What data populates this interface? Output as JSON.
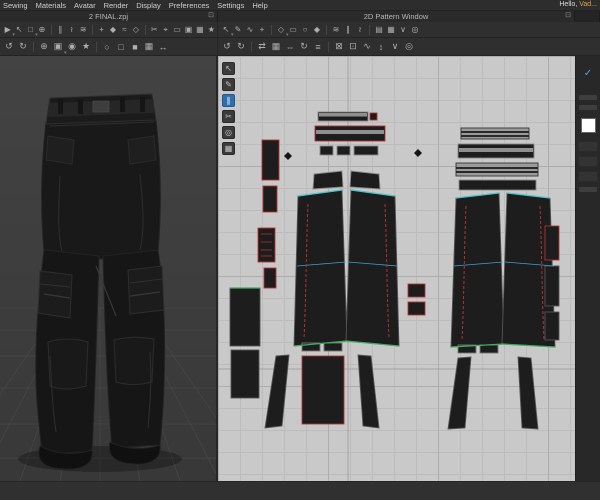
{
  "colors": {
    "accent_blue": "#4aa3e8",
    "selection_red": "#b03434",
    "seam_cyan": "#45c8d2",
    "seam_green": "#3fae5f",
    "greeting_name_color": "#e0a33c",
    "pattern_canvas_bg": "#c9c9c9",
    "viewport_bg": "#3e3e3e"
  },
  "menu_bar": {
    "items": [
      "Sewing",
      "Materials",
      "Avatar",
      "Render",
      "Display",
      "Preferences",
      "Settings",
      "Help"
    ],
    "greeting_prefix": "Hello, ",
    "greeting_name": "Vad..."
  },
  "title_bar": {
    "left_tab": "2 FINAL.zpj",
    "right_tab": "2D Pattern Window",
    "window_control_glyph": "⊡"
  },
  "toolbars": {
    "row1_3d": [
      {
        "name": "simulate",
        "glyph": "▶",
        "caret": true
      },
      {
        "name": "select-move",
        "glyph": "↖"
      },
      {
        "name": "select-mesh",
        "glyph": "□",
        "caret": true
      },
      {
        "name": "pin",
        "glyph": "⊕"
      },
      {
        "sep": true
      },
      {
        "name": "segment-sewing",
        "glyph": "∥"
      },
      {
        "name": "free-sewing",
        "glyph": "≀"
      },
      {
        "name": "show-sewing",
        "glyph": "≋"
      },
      {
        "sep": true
      },
      {
        "name": "pinch",
        "glyph": "+"
      },
      {
        "name": "tack",
        "glyph": "◆"
      },
      {
        "name": "steam",
        "glyph": "≈"
      },
      {
        "name": "fold-arrangement",
        "glyph": "◇"
      },
      {
        "sep": true
      },
      {
        "name": "scissors",
        "glyph": "✂"
      },
      {
        "name": "measure",
        "glyph": "⌖"
      },
      {
        "name": "tape",
        "glyph": "▭"
      },
      {
        "name": "flatten",
        "glyph": "▣"
      },
      {
        "name": "grid-3d",
        "glyph": "▦"
      },
      {
        "name": "render",
        "glyph": "★"
      }
    ],
    "row1_2d": [
      {
        "name": "transform-pattern",
        "glyph": "↖",
        "caret": true
      },
      {
        "name": "edit-pattern",
        "glyph": "✎"
      },
      {
        "name": "edit-curvature",
        "glyph": "∿"
      },
      {
        "name": "add-point",
        "glyph": "+"
      },
      {
        "sep": true
      },
      {
        "name": "polygon",
        "glyph": "◇",
        "caret": true
      },
      {
        "name": "rectangle",
        "glyph": "▭"
      },
      {
        "name": "circle",
        "glyph": "○"
      },
      {
        "name": "dart",
        "glyph": "◆"
      },
      {
        "sep": true
      },
      {
        "name": "seam-allowance",
        "glyph": "≋"
      },
      {
        "name": "segment-sewing-2d",
        "glyph": "∥"
      },
      {
        "name": "free-sewing-2d",
        "glyph": "≀"
      },
      {
        "sep": true
      },
      {
        "name": "grading",
        "glyph": "▤"
      },
      {
        "name": "texture-editor",
        "glyph": "▦"
      },
      {
        "name": "notch",
        "glyph": "∨"
      },
      {
        "name": "zoom",
        "glyph": "◎"
      }
    ],
    "row2_3d": [
      {
        "name": "undo",
        "glyph": "↺"
      },
      {
        "name": "redo",
        "glyph": "↻"
      },
      {
        "sep": true
      },
      {
        "name": "reset-arrangement",
        "glyph": "⊕"
      },
      {
        "name": "camera-view",
        "glyph": "▣",
        "caret": true
      },
      {
        "name": "snapshot",
        "glyph": "◉"
      },
      {
        "name": "render-image",
        "glyph": "★"
      },
      {
        "sep": true
      },
      {
        "name": "show-avatar",
        "glyph": "○"
      },
      {
        "name": "show-garment",
        "glyph": "□"
      },
      {
        "name": "shadow-toggle",
        "glyph": "■"
      },
      {
        "name": "grid-toggle",
        "glyph": "▦"
      },
      {
        "name": "fit-view",
        "glyph": "↔"
      }
    ],
    "row2_2d": [
      {
        "name": "undo-2d",
        "glyph": "↺"
      },
      {
        "name": "redo-2d",
        "glyph": "↻"
      },
      {
        "sep": true
      },
      {
        "name": "sync-3d",
        "glyph": "⇄"
      },
      {
        "name": "arrange-patterns",
        "glyph": "▦"
      },
      {
        "name": "mirror-paste",
        "glyph": "⇔"
      },
      {
        "name": "rotate-pattern",
        "glyph": "↻"
      },
      {
        "name": "align",
        "glyph": "≡"
      },
      {
        "sep": true
      },
      {
        "name": "lock-pattern",
        "glyph": "⊠"
      },
      {
        "name": "unlock-pattern",
        "glyph": "⊡"
      },
      {
        "name": "show-seamline",
        "glyph": "∿"
      },
      {
        "name": "show-grainline",
        "glyph": "↕"
      },
      {
        "name": "show-notches",
        "glyph": "∨"
      },
      {
        "name": "reset-zoom",
        "glyph": "◎"
      }
    ],
    "side_2d": [
      {
        "name": "transform-pattern-tool",
        "glyph": "↖"
      },
      {
        "name": "edit-pattern-tool",
        "glyph": "✎"
      },
      {
        "name": "sewing-tool",
        "glyph": "∥",
        "active": true
      },
      {
        "name": "scissors-tool",
        "glyph": "✂"
      },
      {
        "name": "zoom-tool",
        "glyph": "◎"
      },
      {
        "name": "snap-toggle",
        "glyph": "▦"
      }
    ]
  },
  "sidebar_right": {
    "check_glyph": "✓"
  }
}
